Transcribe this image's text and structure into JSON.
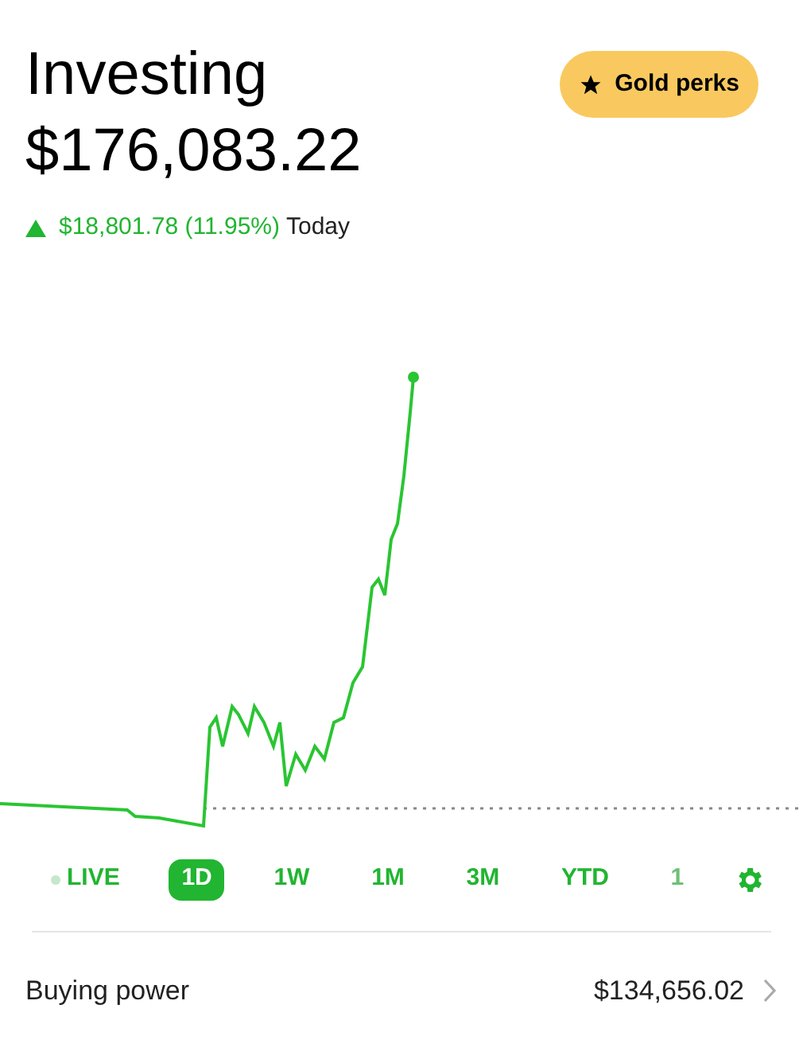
{
  "header": {
    "title": "Investing",
    "value": "$176,083.22",
    "perks_button": "Gold perks"
  },
  "change": {
    "amount": "$18,801.78 (11.95%)",
    "period": "Today",
    "rising": true
  },
  "ranges": [
    {
      "label": "LIVE",
      "kind": "live",
      "selected": false
    },
    {
      "label": "1D",
      "kind": "range",
      "selected": true
    },
    {
      "label": "1W",
      "kind": "range",
      "selected": false
    },
    {
      "label": "1M",
      "kind": "range",
      "selected": false
    },
    {
      "label": "3M",
      "kind": "range",
      "selected": false
    },
    {
      "label": "YTD",
      "kind": "range",
      "selected": false
    },
    {
      "label": "1",
      "kind": "faded",
      "selected": false
    }
  ],
  "buying_power": {
    "label": "Buying power",
    "value": "$134,656.02"
  }
}
